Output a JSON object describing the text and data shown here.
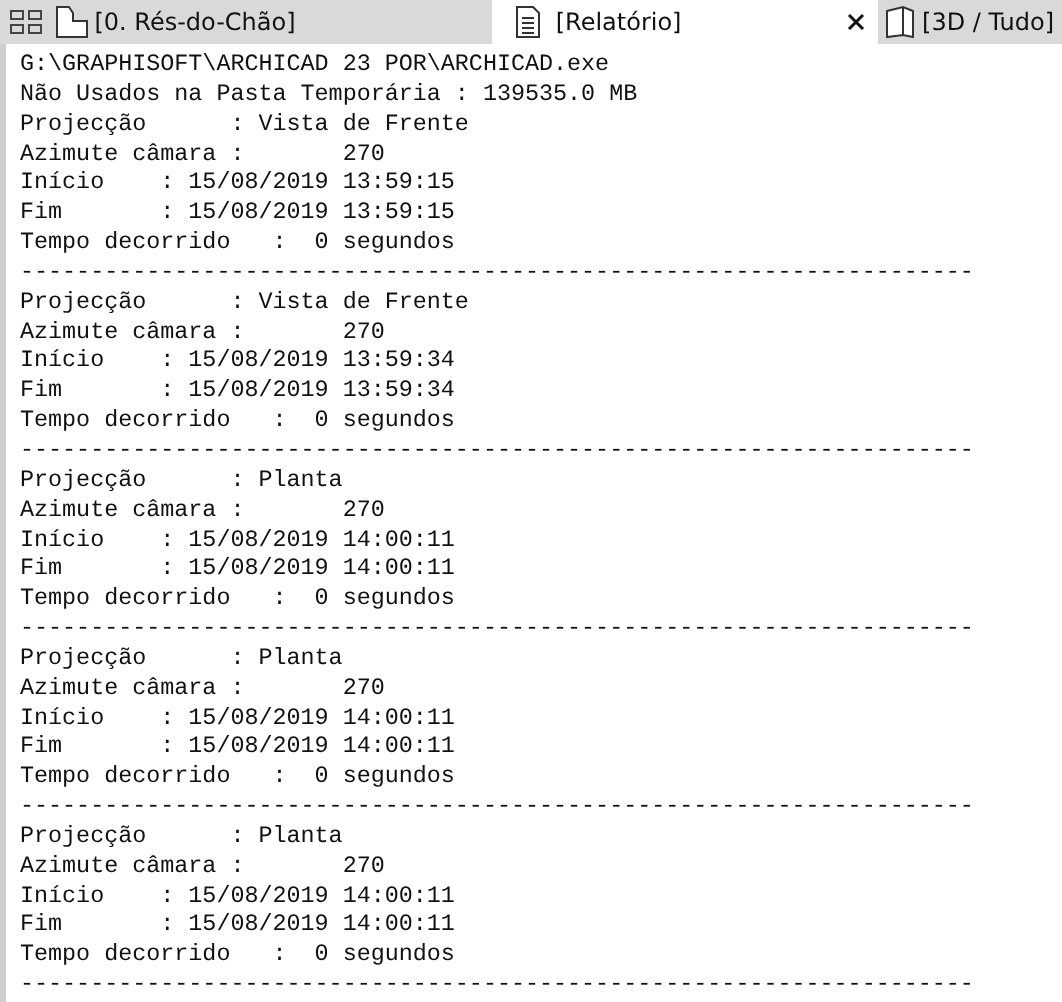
{
  "tabs": [
    {
      "kind": "plan",
      "label": "[0. Rés-do-Chão]",
      "selected": false
    },
    {
      "kind": "document",
      "label": "[Relatório]",
      "selected": true
    },
    {
      "kind": "box3d",
      "label": "[3D / Tudo]",
      "selected": false
    }
  ],
  "report": {
    "lines": [
      "G:\\GRAPHISOFT\\ARCHICAD 23 POR\\ARCHICAD.exe",
      "Não Usados na Pasta Temporária : 139535.0 MB",
      "Projecção      : Vista de Frente",
      "Azimute câmara :       270",
      "Início    : 15/08/2019 13:59:15",
      "Fim       : 15/08/2019 13:59:15",
      "Tempo decorrido   :  0 segundos",
      "--------------------------------------------------------------------",
      "Projecção      : Vista de Frente",
      "Azimute câmara :       270",
      "Início    : 15/08/2019 13:59:34",
      "Fim       : 15/08/2019 13:59:34",
      "Tempo decorrido   :  0 segundos",
      "--------------------------------------------------------------------",
      "Projecção      : Planta",
      "Azimute câmara :       270",
      "Início    : 15/08/2019 14:00:11",
      "Fim       : 15/08/2019 14:00:11",
      "Tempo decorrido   :  0 segundos",
      "--------------------------------------------------------------------",
      "Projecção      : Planta",
      "Azimute câmara :       270",
      "Início    : 15/08/2019 14:00:11",
      "Fim       : 15/08/2019 14:00:11",
      "Tempo decorrido   :  0 segundos",
      "--------------------------------------------------------------------",
      "Projecção      : Planta",
      "Azimute câmara :       270",
      "Início    : 15/08/2019 14:00:11",
      "Fim       : 15/08/2019 14:00:11",
      "Tempo decorrido   :  0 segundos",
      "--------------------------------------------------------------------"
    ]
  }
}
